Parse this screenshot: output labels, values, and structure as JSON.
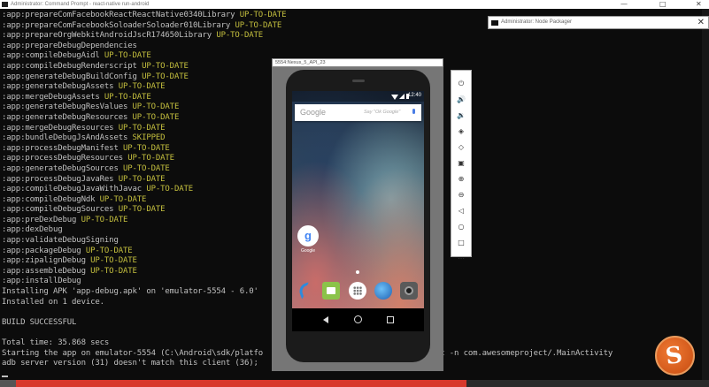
{
  "cmd": {
    "title": "Administrator: Command Prompt - react-native run-android",
    "minimize": "—",
    "maximize": "□",
    "close": "✕",
    "lines": [
      {
        "t": ":app:prepareComFacebookReactReactNative0340Library ",
        "s": "UP-TO-DATE"
      },
      {
        "t": ":app:prepareComFacebookSoloaderSoloader010Library ",
        "s": "UP-TO-DATE"
      },
      {
        "t": ":app:prepareOrgWebkitAndroidJscR174650Library ",
        "s": "UP-TO-DATE"
      },
      {
        "t": ":app:prepareDebugDependencies",
        "s": ""
      },
      {
        "t": ":app:compileDebugAidl ",
        "s": "UP-TO-DATE"
      },
      {
        "t": ":app:compileDebugRenderscript ",
        "s": "UP-TO-DATE"
      },
      {
        "t": ":app:generateDebugBuildConfig ",
        "s": "UP-TO-DATE"
      },
      {
        "t": ":app:generateDebugAssets ",
        "s": "UP-TO-DATE"
      },
      {
        "t": ":app:mergeDebugAssets ",
        "s": "UP-TO-DATE"
      },
      {
        "t": ":app:generateDebugResValues ",
        "s": "UP-TO-DATE"
      },
      {
        "t": ":app:generateDebugResources ",
        "s": "UP-TO-DATE"
      },
      {
        "t": ":app:mergeDebugResources ",
        "s": "UP-TO-DATE"
      },
      {
        "t": ":app:bundleDebugJsAndAssets ",
        "s": "SKIPPED"
      },
      {
        "t": ":app:processDebugManifest ",
        "s": "UP-TO-DATE"
      },
      {
        "t": ":app:processDebugResources ",
        "s": "UP-TO-DATE"
      },
      {
        "t": ":app:generateDebugSources ",
        "s": "UP-TO-DATE"
      },
      {
        "t": ":app:processDebugJavaRes ",
        "s": "UP-TO-DATE"
      },
      {
        "t": ":app:compileDebugJavaWithJavac ",
        "s": "UP-TO-DATE"
      },
      {
        "t": ":app:compileDebugNdk ",
        "s": "UP-TO-DATE"
      },
      {
        "t": ":app:compileDebugSources ",
        "s": "UP-TO-DATE"
      },
      {
        "t": ":app:preDexDebug ",
        "s": "UP-TO-DATE"
      },
      {
        "t": ":app:dexDebug",
        "s": ""
      },
      {
        "t": ":app:validateDebugSigning",
        "s": ""
      },
      {
        "t": ":app:packageDebug ",
        "s": "UP-TO-DATE"
      },
      {
        "t": ":app:zipalignDebug ",
        "s": "UP-TO-DATE"
      },
      {
        "t": ":app:assembleDebug ",
        "s": "UP-TO-DATE"
      },
      {
        "t": ":app:installDebug",
        "s": ""
      },
      {
        "t": "Installing APK 'app-debug.apk' on 'emulator-5554 - 6.0'",
        "s": ""
      },
      {
        "t": "Installed on 1 device.",
        "s": ""
      },
      {
        "t": "",
        "s": ""
      },
      {
        "t": "BUILD SUCCESSFUL",
        "s": ""
      },
      {
        "t": "",
        "s": ""
      },
      {
        "t": "Total time: 35.868 secs",
        "s": ""
      },
      {
        "t": "Starting the app on emulator-5554 (C:\\Android\\sdk/platfo                               am start -n com.awesomeproject/.MainActivity",
        "s": ""
      },
      {
        "t": "adb server version (31) doesn't match this client (36);",
        "s": ""
      }
    ]
  },
  "adb": {
    "title": "Administrator: Node Packager",
    "close": "✕"
  },
  "emulator": {
    "title": "5554:Nexus_5_API_23",
    "time": "12:40",
    "search_brand": "Google",
    "search_hint": "Say \"Ok Google\"",
    "google_app_label": "Google",
    "google_app_letter": "g"
  },
  "side_panel": {
    "icons": [
      "⏻",
      "🔊",
      "🔉",
      "◈",
      "◇",
      "▣",
      "⊕",
      "⊖",
      "◁",
      "○",
      "□",
      "⋯"
    ]
  },
  "video": {
    "progress": 0.65,
    "channel_letter": "S"
  }
}
